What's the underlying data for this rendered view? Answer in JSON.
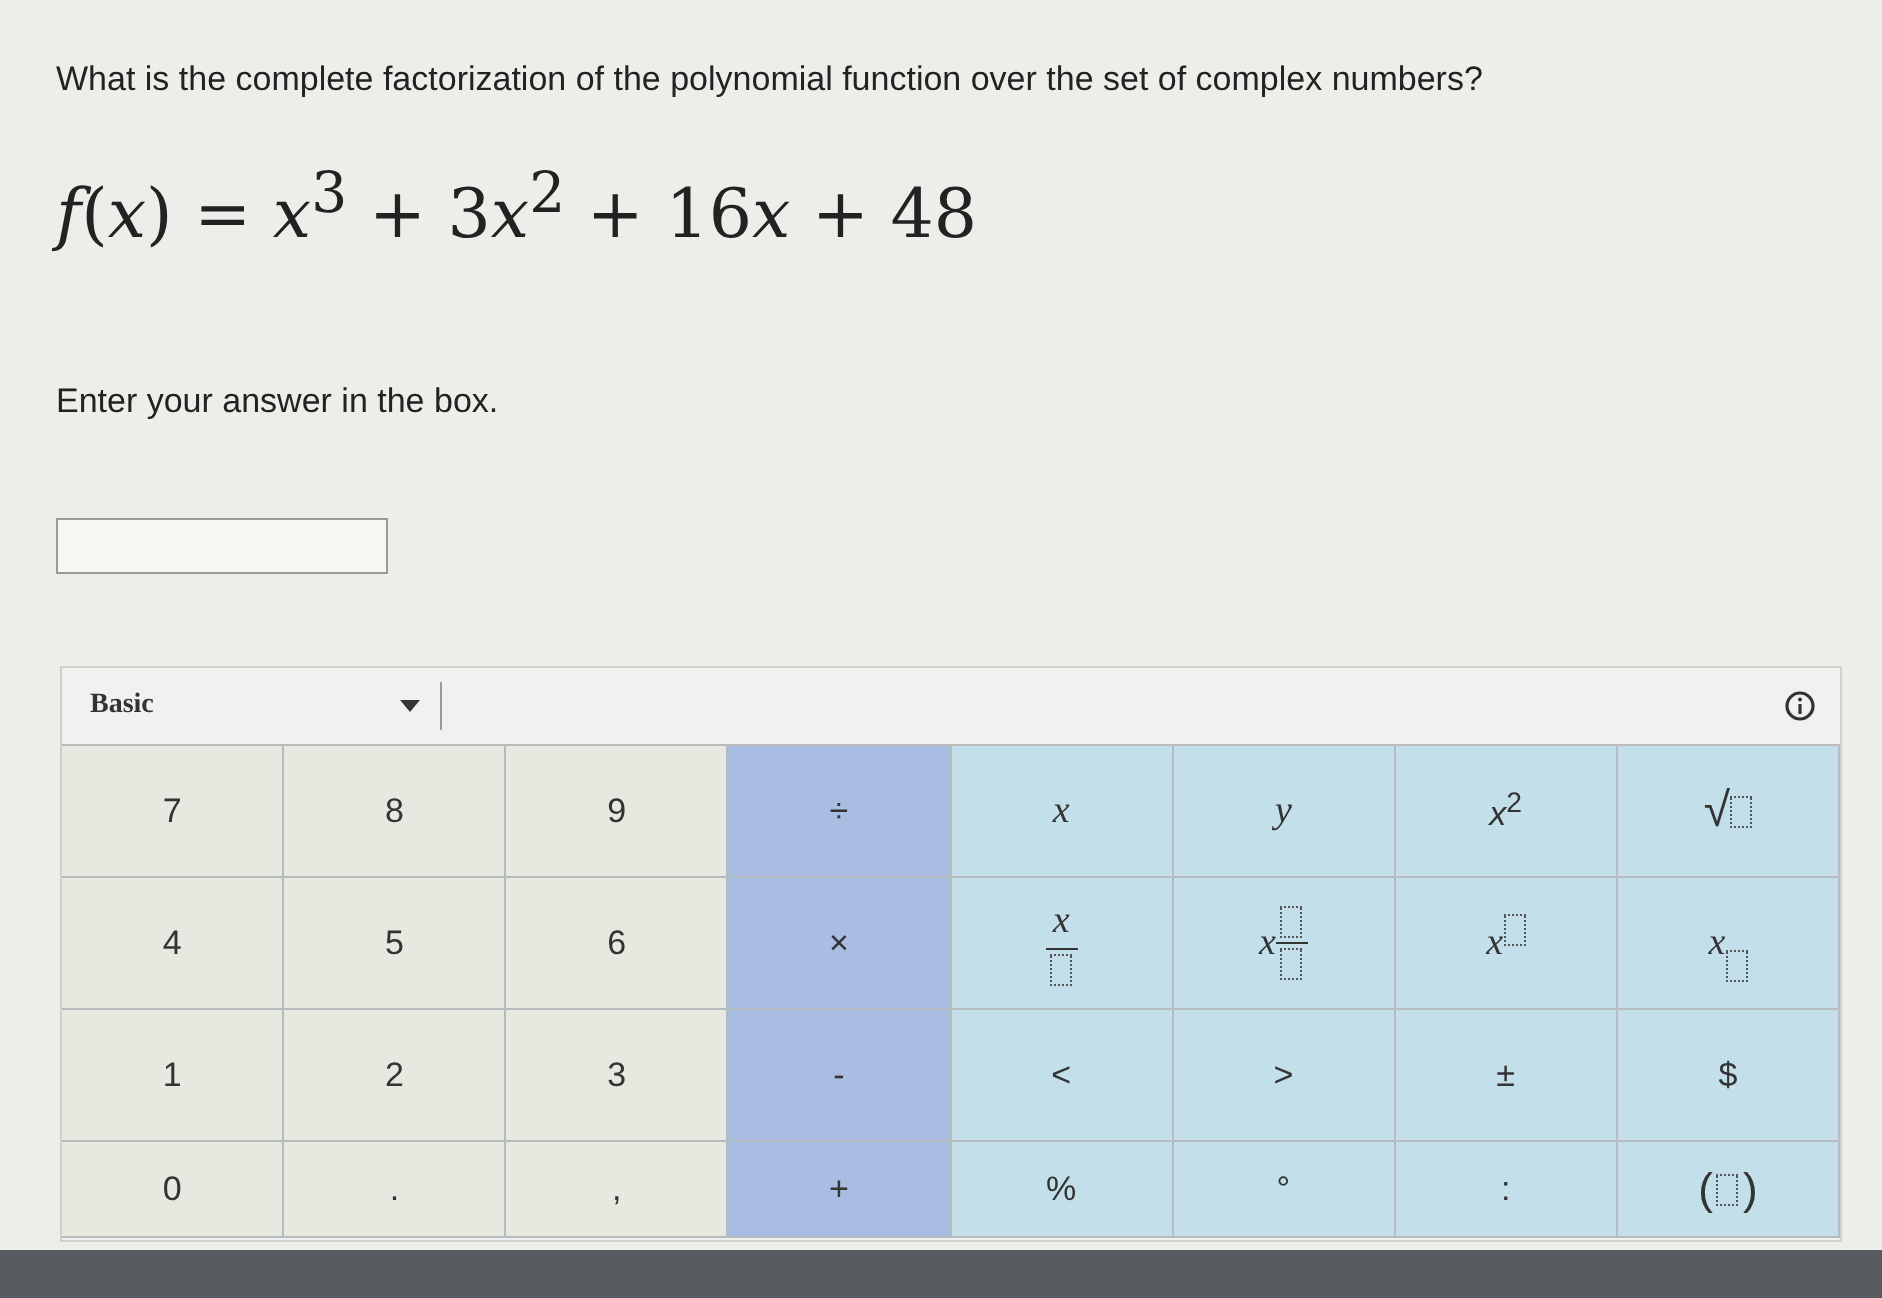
{
  "question": "What is the complete factorization of the polynomial function over the set of complex numbers?",
  "formula": [
    "*f*(*x*) = *x*$^{3}$ + 3",
    "*x*$^{2}$ + 16",
    "*x* + 48"
  ],
  "instruction": "Enter your answer in the box.",
  "keypad": {
    "mode": "Basic",
    "keys": [
      {
        "color": "#e7e8e0",
        "kind": "text",
        "label": "7"
      },
      {
        "color": "#e7e8e0",
        "kind": "text",
        "label": "8"
      },
      {
        "color": "#e7e8e0",
        "kind": "text",
        "label": "9"
      },
      {
        "color": "#a9bde3",
        "kind": "text",
        "label": "÷"
      },
      {
        "color": "#c3dfea",
        "kind": "italic",
        "label": "x"
      },
      {
        "color": "#c3dfea",
        "kind": "italic",
        "label": "y"
      },
      {
        "color": "#c3dfea",
        "kind": "rich",
        "label": "*x*$^{2}$"
      },
      {
        "color": "#c3dfea",
        "kind": "sqrt",
        "label": "√"
      },
      {
        "color": "#e7e8e0",
        "kind": "text",
        "label": "4"
      },
      {
        "color": "#e7e8e0",
        "kind": "text",
        "label": "5"
      },
      {
        "color": "#e7e8e0",
        "kind": "text",
        "label": "6"
      },
      {
        "color": "#a9bde3",
        "kind": "text",
        "label": "×"
      },
      {
        "color": "#c3dfea",
        "kind": "frac",
        "label": "x"
      },
      {
        "color": "#c3dfea",
        "kind": "mixed",
        "label": "x"
      },
      {
        "color": "#c3dfea",
        "kind": "power",
        "label": "x"
      },
      {
        "color": "#c3dfea",
        "kind": "sub",
        "label": "x"
      },
      {
        "color": "#e7e8e0",
        "kind": "text",
        "label": "1"
      },
      {
        "color": "#e7e8e0",
        "kind": "text",
        "label": "2"
      },
      {
        "color": "#e7e8e0",
        "kind": "text",
        "label": "3"
      },
      {
        "color": "#a9bde3",
        "kind": "text",
        "label": "-"
      },
      {
        "color": "#c3dfea",
        "kind": "text",
        "label": "<"
      },
      {
        "color": "#c3dfea",
        "kind": "text",
        "label": ">"
      },
      {
        "color": "#c3dfea",
        "kind": "text",
        "label": "±"
      },
      {
        "color": "#c3dfea",
        "kind": "text",
        "label": "$"
      },
      {
        "color": "#e7e8e0",
        "kind": "text",
        "label": "0"
      },
      {
        "color": "#e7e8e0",
        "kind": "text",
        "label": "."
      },
      {
        "color": "#e7e8e0",
        "kind": "text",
        "label": ","
      },
      {
        "color": "#a9bde3",
        "kind": "text",
        "label": "+"
      },
      {
        "color": "#c3dfea",
        "kind": "text",
        "label": "%"
      },
      {
        "color": "#c3dfea",
        "kind": "text",
        "label": "°"
      },
      {
        "color": "#c3dfea",
        "kind": "text",
        "label": ":"
      },
      {
        "color": "#c3dfea",
        "kind": "paren",
        "label": "(",
        "label2": ")"
      }
    ]
  }
}
